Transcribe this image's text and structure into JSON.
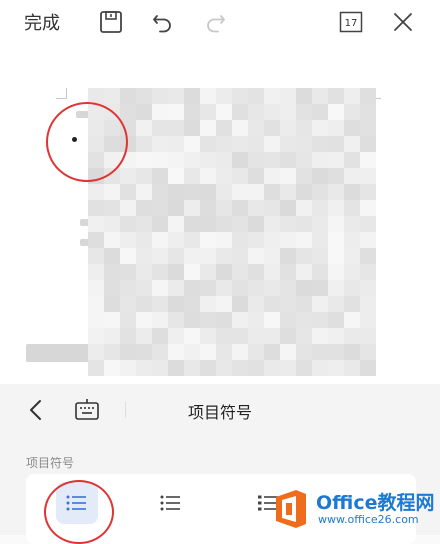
{
  "toolbar": {
    "done_label": "完成",
    "page_count_label": "17"
  },
  "panel": {
    "title": "项目符号",
    "section_label": "项目符号"
  },
  "watermark": {
    "title": "Office教程网",
    "url": "www.office26.com"
  },
  "colors": {
    "annotation_red": "#e03434",
    "selected_bg": "#e3eaf8",
    "selected_icon": "#3b73d8",
    "watermark_blue": "#1e7ad1",
    "watermark_orange": "#ef6c1d"
  },
  "icons": {
    "save": "save-icon",
    "undo": "undo-icon",
    "redo": "redo-icon",
    "calendar": "calendar-icon",
    "close": "close-icon",
    "back": "chevron-left-icon",
    "keyboard": "keyboard-icon",
    "list": "list-icon"
  }
}
